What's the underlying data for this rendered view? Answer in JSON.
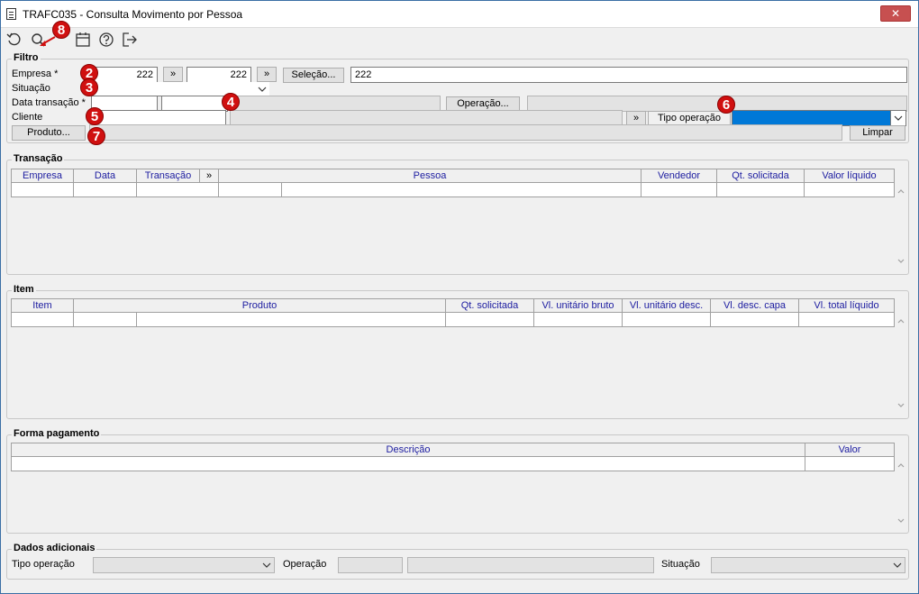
{
  "window": {
    "title": "TRAFC035 - Consulta Movimento por Pessoa",
    "close_label": "✕"
  },
  "toolbar": {
    "icons": [
      "refresh-icon",
      "search-icon",
      "calendar-icon",
      "help-icon",
      "exit-icon"
    ]
  },
  "markers": [
    "2",
    "3",
    "4",
    "5",
    "6",
    "7",
    "8"
  ],
  "filtro": {
    "title": "Filtro",
    "empresa_label": "Empresa *",
    "empresa_from": "222",
    "empresa_to": "222",
    "expand_label": "»",
    "selecao_label": "Seleção...",
    "selecao_value": "222",
    "situacao_label": "Situação",
    "data_label": "Data transação *",
    "operacao_label": "Operação...",
    "cliente_label": "Cliente",
    "tipo_operacao_label": "Tipo operação",
    "produto_label": "Produto...",
    "limpar_label": "Limpar"
  },
  "transacao": {
    "title": "Transação",
    "columns": [
      "Empresa",
      "Data",
      "Transação",
      "»",
      "Pessoa",
      "Vendedor",
      "Qt. solicitada",
      "Valor líquido"
    ]
  },
  "item": {
    "title": "Item",
    "columns": [
      "Item",
      "Produto",
      "Qt. solicitada",
      "Vl. unitário bruto",
      "Vl. unitário desc.",
      "Vl. desc. capa",
      "Vl. total líquido"
    ]
  },
  "forma_pagamento": {
    "title": "Forma pagamento",
    "columns": [
      "Descrição",
      "Valor"
    ]
  },
  "dados_adicionais": {
    "title": "Dados adicionais",
    "tipo_operacao_label": "Tipo operação",
    "operacao_label": "Operação",
    "situacao_label": "Situação"
  },
  "colors": {
    "marker": "#d01010",
    "header_text": "#1c1ca0",
    "selected_blue": "#0078d7",
    "close_red": "#c75050"
  }
}
